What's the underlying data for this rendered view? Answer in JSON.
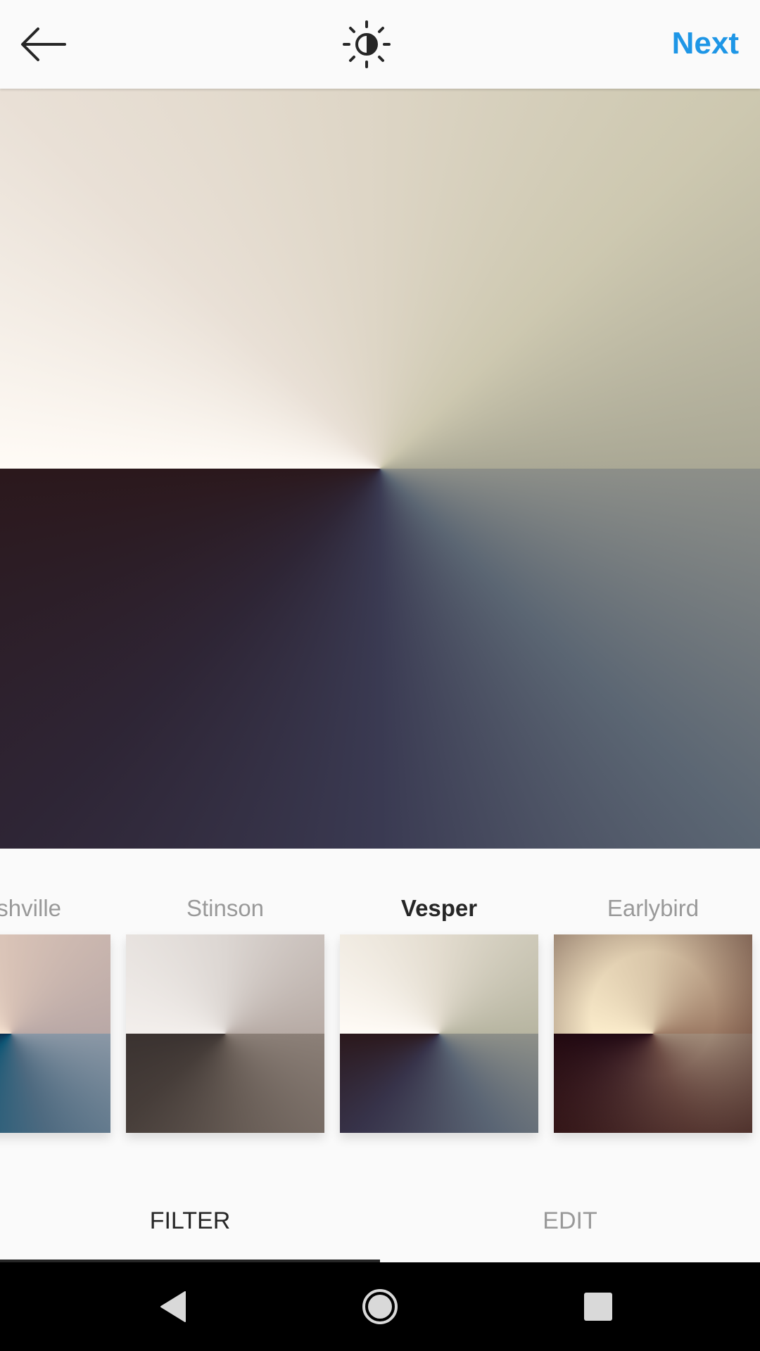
{
  "header": {
    "back_icon": "arrow-left-icon",
    "lux_icon": "brightness-contrast-icon",
    "next_label": "Next",
    "next_color": "#1e96e6"
  },
  "preview": {
    "description_colors": [
      "#fffbf6",
      "#cdc8b0",
      "#5b6673",
      "#2b181c"
    ]
  },
  "filters": {
    "items": [
      {
        "name": "shville",
        "selected": false
      },
      {
        "name": "Stinson",
        "selected": false
      },
      {
        "name": "Vesper",
        "selected": true
      },
      {
        "name": "Earlybird",
        "selected": false
      }
    ]
  },
  "tabs": {
    "filter_label": "FILTER",
    "edit_label": "EDIT",
    "active": "FILTER"
  },
  "navbar": {
    "back_icon": "triangle-back-icon",
    "home_icon": "circle-home-icon",
    "recents_icon": "square-recents-icon"
  }
}
